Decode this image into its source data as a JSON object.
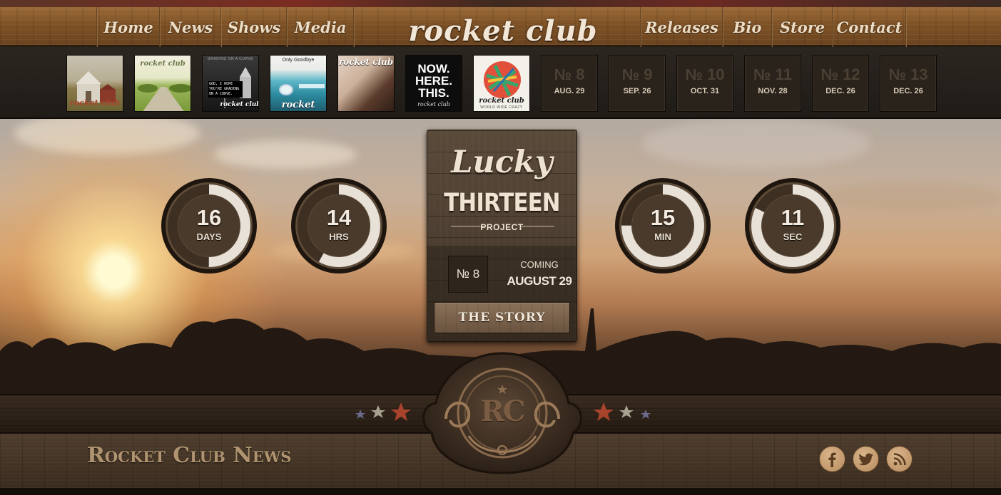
{
  "nav": {
    "left": [
      "Home",
      "News",
      "Shows",
      "Media"
    ],
    "logo": "rocket club",
    "right": [
      "Releases",
      "Bio",
      "Store",
      "Contact"
    ]
  },
  "releases": {
    "covers": [
      {
        "name": "cover-barn",
        "caption": "rocket club",
        "extra": "ITALY"
      },
      {
        "name": "cover-road",
        "caption": "rocket club"
      },
      {
        "name": "cover-sign",
        "caption": "rocket club",
        "top": "GRADING ON A CURVE",
        "sign": "GOD, I HOPE YOU'RE GRADING ON A CURVE."
      },
      {
        "name": "cover-car",
        "caption": "rocket club",
        "top": "Only Goodbye"
      },
      {
        "name": "cover-hair",
        "caption": "rocket club"
      },
      {
        "name": "cover-now",
        "big1": "NOW.",
        "big2": "HERE.",
        "big3": "THIS.",
        "caption": "rocket club"
      },
      {
        "name": "cover-crazy",
        "caption": "rocket club",
        "sub": "WORLD WIDE CRAZY"
      }
    ],
    "upcoming": [
      {
        "num": "№ 8",
        "date": "AUG. 29"
      },
      {
        "num": "№ 9",
        "date": "SEP. 26"
      },
      {
        "num": "№ 10",
        "date": "OCT. 31"
      },
      {
        "num": "№ 11",
        "date": "NOV. 28"
      },
      {
        "num": "№ 12",
        "date": "DEC. 26"
      },
      {
        "num": "№ 13",
        "date": "DEC. 26"
      }
    ]
  },
  "countdown": [
    {
      "value": "16",
      "unit": "DAYS",
      "fraction": 0.5
    },
    {
      "value": "14",
      "unit": "HRS",
      "fraction": 0.58
    },
    {
      "value": "15",
      "unit": "MIN",
      "fraction": 0.75
    },
    {
      "value": "11",
      "unit": "SEC",
      "fraction": 0.82
    }
  ],
  "feature": {
    "lucky": "Lucky",
    "thirteen": "THIRTEEN",
    "project": "PROJECT",
    "number": "№ 8",
    "coming": "COMING",
    "date": "AUGUST 29",
    "button": "THE STORY"
  },
  "emblem": {
    "initials": "RC"
  },
  "news": {
    "title": "Rocket Club News"
  },
  "social": [
    "facebook-icon",
    "twitter-icon",
    "rss-icon"
  ],
  "colors": {
    "wood": "#7e5226",
    "cream": "#efe3d3",
    "accent_red": "#a8442c"
  }
}
